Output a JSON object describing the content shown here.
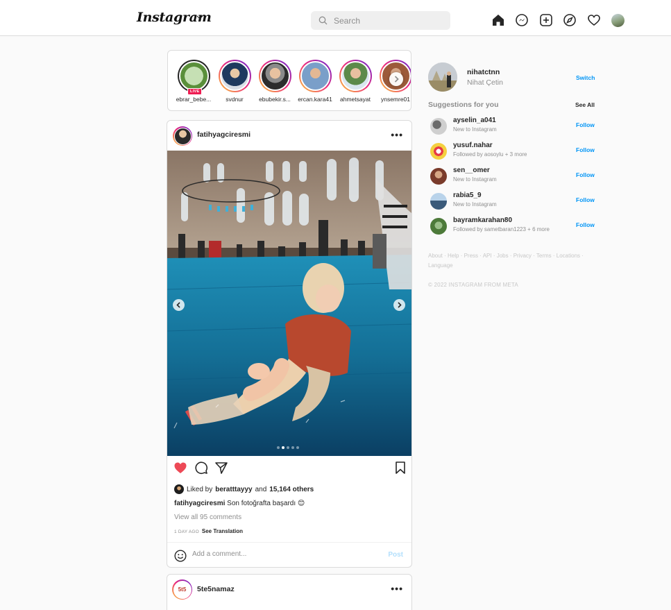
{
  "topbar": {
    "logo": "Instagram",
    "search_placeholder": "Search",
    "icons": [
      "home-icon",
      "messenger-icon",
      "new-post-icon",
      "explore-icon",
      "activity-heart-icon",
      "profile-avatar"
    ]
  },
  "stories": [
    {
      "name": "ebrar_bebe...",
      "live": true,
      "live_label": "LIVE"
    },
    {
      "name": "svdnur"
    },
    {
      "name": "ebubekir.s..."
    },
    {
      "name": "ercan.kara41"
    },
    {
      "name": "ahmetsayat"
    },
    {
      "name": "ynsemre01"
    }
  ],
  "post": {
    "username": "fatihyagciresmi",
    "more": "•••",
    "liked_by_prefix": "Liked by",
    "liked_by_user": "beratttayyy",
    "liked_by_and": "and",
    "liked_by_others": "15,164 others",
    "caption_user": "fatihyagciresmi",
    "caption_text": "Son fotoğrafta başardı 😊",
    "view_comments": "View all 95 comments",
    "time": "1 DAY AGO",
    "see_translation": "See Translation",
    "comment_placeholder": "Add a comment...",
    "post_button": "Post",
    "carousel_index": 2,
    "carousel_count": 5,
    "liked": true
  },
  "post2": {
    "username": "5te5namaz",
    "avatar_text": "5t5",
    "more": "•••"
  },
  "sidebar": {
    "me_username": "nihatctnn",
    "me_name": "Nihat Çetin",
    "switch": "Switch",
    "suggestions_title": "Suggestions for you",
    "see_all": "See All",
    "suggestions": [
      {
        "username": "ayselin_a041",
        "subtitle": "New to Instagram",
        "action": "Follow"
      },
      {
        "username": "yusuf.nahar",
        "subtitle": "Followed by aosoylu + 3 more",
        "action": "Follow"
      },
      {
        "username": "sen__omer",
        "subtitle": "New to Instagram",
        "action": "Follow"
      },
      {
        "username": "rabia5_9",
        "subtitle": "New to Instagram",
        "action": "Follow"
      },
      {
        "username": "bayramkarahan80",
        "subtitle": "Followed by sametbaran1223 + 6 more",
        "action": "Follow"
      }
    ],
    "footer_links": "About · Help · Press · API · Jobs · Privacy · Terms · Locations · Language",
    "copyright": "© 2022 INSTAGRAM FROM META"
  }
}
